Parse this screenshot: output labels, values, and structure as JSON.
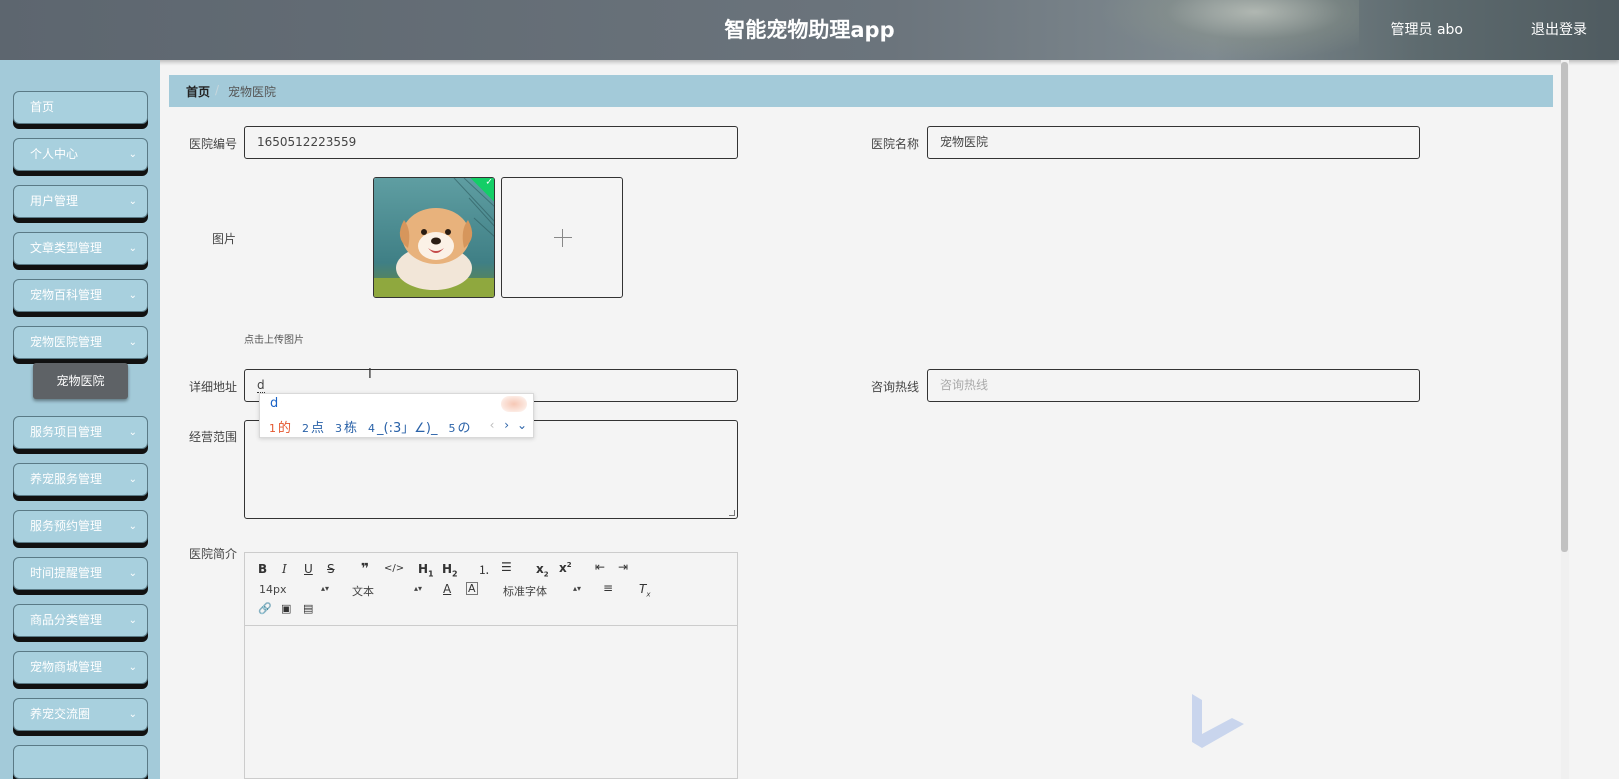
{
  "header": {
    "app_title": "智能宠物助理app",
    "user_label": "管理员 abo",
    "logout_label": "退出登录"
  },
  "sidebar": {
    "items": [
      {
        "label": "首页",
        "has_arrow": false
      },
      {
        "label": "个人中心",
        "has_arrow": true
      },
      {
        "label": "用户管理",
        "has_arrow": true
      },
      {
        "label": "文章类型管理",
        "has_arrow": true
      },
      {
        "label": "宠物百科管理",
        "has_arrow": true
      },
      {
        "label": "宠物医院管理",
        "has_arrow": true
      },
      {
        "label": "服务项目管理",
        "has_arrow": true
      },
      {
        "label": "养宠服务管理",
        "has_arrow": true
      },
      {
        "label": "服务预约管理",
        "has_arrow": true
      },
      {
        "label": "时间提醒管理",
        "has_arrow": true
      },
      {
        "label": "商品分类管理",
        "has_arrow": true
      },
      {
        "label": "宠物商城管理",
        "has_arrow": true
      },
      {
        "label": "养宠交流圈",
        "has_arrow": true
      }
    ],
    "submenu": {
      "label": "宠物医院"
    }
  },
  "breadcrumb": {
    "home": "首页",
    "separator": "/",
    "current": "宠物医院"
  },
  "form": {
    "hospital_id": {
      "label": "医院编号",
      "value": "1650512223559"
    },
    "hospital_name": {
      "label": "医院名称",
      "value": "宠物医院"
    },
    "image": {
      "label": "图片",
      "hint": "点击上传图片"
    },
    "address": {
      "label": "详细地址",
      "value": "d"
    },
    "hotline": {
      "label": "咨询热线",
      "placeholder": "咨询热线"
    },
    "scope": {
      "label": "经营范围"
    },
    "intro": {
      "label": "医院简介"
    }
  },
  "ime": {
    "typed": "d",
    "candidates": [
      {
        "num": "1",
        "text": "的"
      },
      {
        "num": "2",
        "text": "点"
      },
      {
        "num": "3",
        "text": "栋"
      },
      {
        "num": "4",
        "text": "_(:3」∠)_"
      },
      {
        "num": "5",
        "text": "の"
      }
    ],
    "nav_prev": "‹",
    "nav_next": "›",
    "nav_expand": "⌄"
  },
  "editor": {
    "font_size": "14px",
    "block_type": "文本",
    "font_family": "标准字体",
    "icons": [
      "bold-icon",
      "italic-icon",
      "underline-icon",
      "strike-icon",
      "quote-icon",
      "code-icon",
      "h1-icon",
      "h2-icon",
      "ordered-list-icon",
      "bullet-list-icon",
      "subscript-icon",
      "superscript-icon",
      "outdent-icon",
      "indent-icon",
      "font-color-icon",
      "background-color-icon",
      "align-icon",
      "clear-format-icon",
      "link-icon",
      "image-icon",
      "video-icon"
    ]
  },
  "colors": {
    "sidebar": "#a3cad9",
    "breadcrumb": "#a3cad9",
    "submenu": "#5e6266",
    "ime_selected": "#e4572e",
    "ime_text": "#2a62a8",
    "success": "#13ce66"
  }
}
